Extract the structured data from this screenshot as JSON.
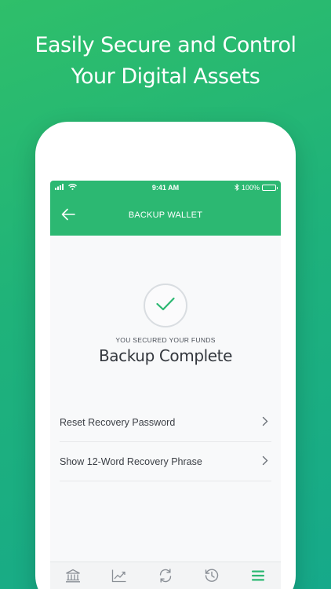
{
  "headline": {
    "line1": "Easily Secure and Control",
    "line2": "Your Digital Assets"
  },
  "status_bar": {
    "time": "9:41 AM",
    "battery": "100%"
  },
  "nav": {
    "title": "BACKUP WALLET"
  },
  "content": {
    "eyebrow": "YOU SECURED YOUR FUNDS",
    "title": "Backup Complete",
    "items": [
      {
        "label": "Reset Recovery Password"
      },
      {
        "label": "Show 12-Word Recovery Phrase"
      }
    ]
  },
  "tabs": [
    {
      "icon": "bank-icon",
      "active": false
    },
    {
      "icon": "chart-icon",
      "active": false
    },
    {
      "icon": "sync-icon",
      "active": false
    },
    {
      "icon": "history-icon",
      "active": false
    },
    {
      "icon": "menu-icon",
      "active": true
    }
  ],
  "colors": {
    "brand_green": "#2cb872",
    "check_green": "#2cb872",
    "icon_gray": "#8a8f96"
  }
}
